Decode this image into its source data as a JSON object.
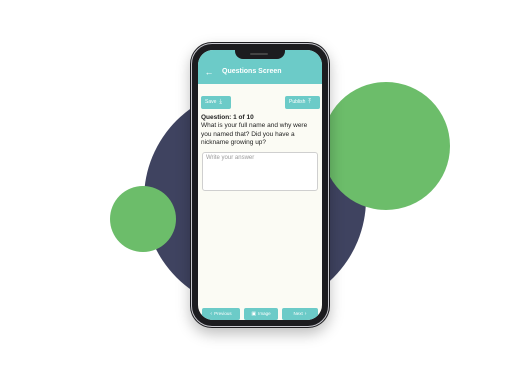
{
  "app": {
    "title": "Questions Screen"
  },
  "toolbar": {
    "save_label": "Save",
    "publish_label": "Publish"
  },
  "question": {
    "counter": "Question: 1 of 10",
    "text": "What is your full name and why were you named that? Did you have a nickname growing up?"
  },
  "answer": {
    "placeholder": "Write your answer"
  },
  "bottom_nav": {
    "previous_label": "Previous",
    "image_label": "Image",
    "next_label": "Next"
  },
  "icons": {
    "back": "arrow-left",
    "save": "download",
    "publish": "upload",
    "previous": "chevron-left",
    "image": "image",
    "next": "chevron-right"
  },
  "colors": {
    "accent": "#6ccbc8",
    "screen_bg": "#fbfbf4",
    "blob_dark": "#3f4360",
    "blob_green": "#6cbd6a",
    "phone_frame": "#1c1c1f"
  }
}
